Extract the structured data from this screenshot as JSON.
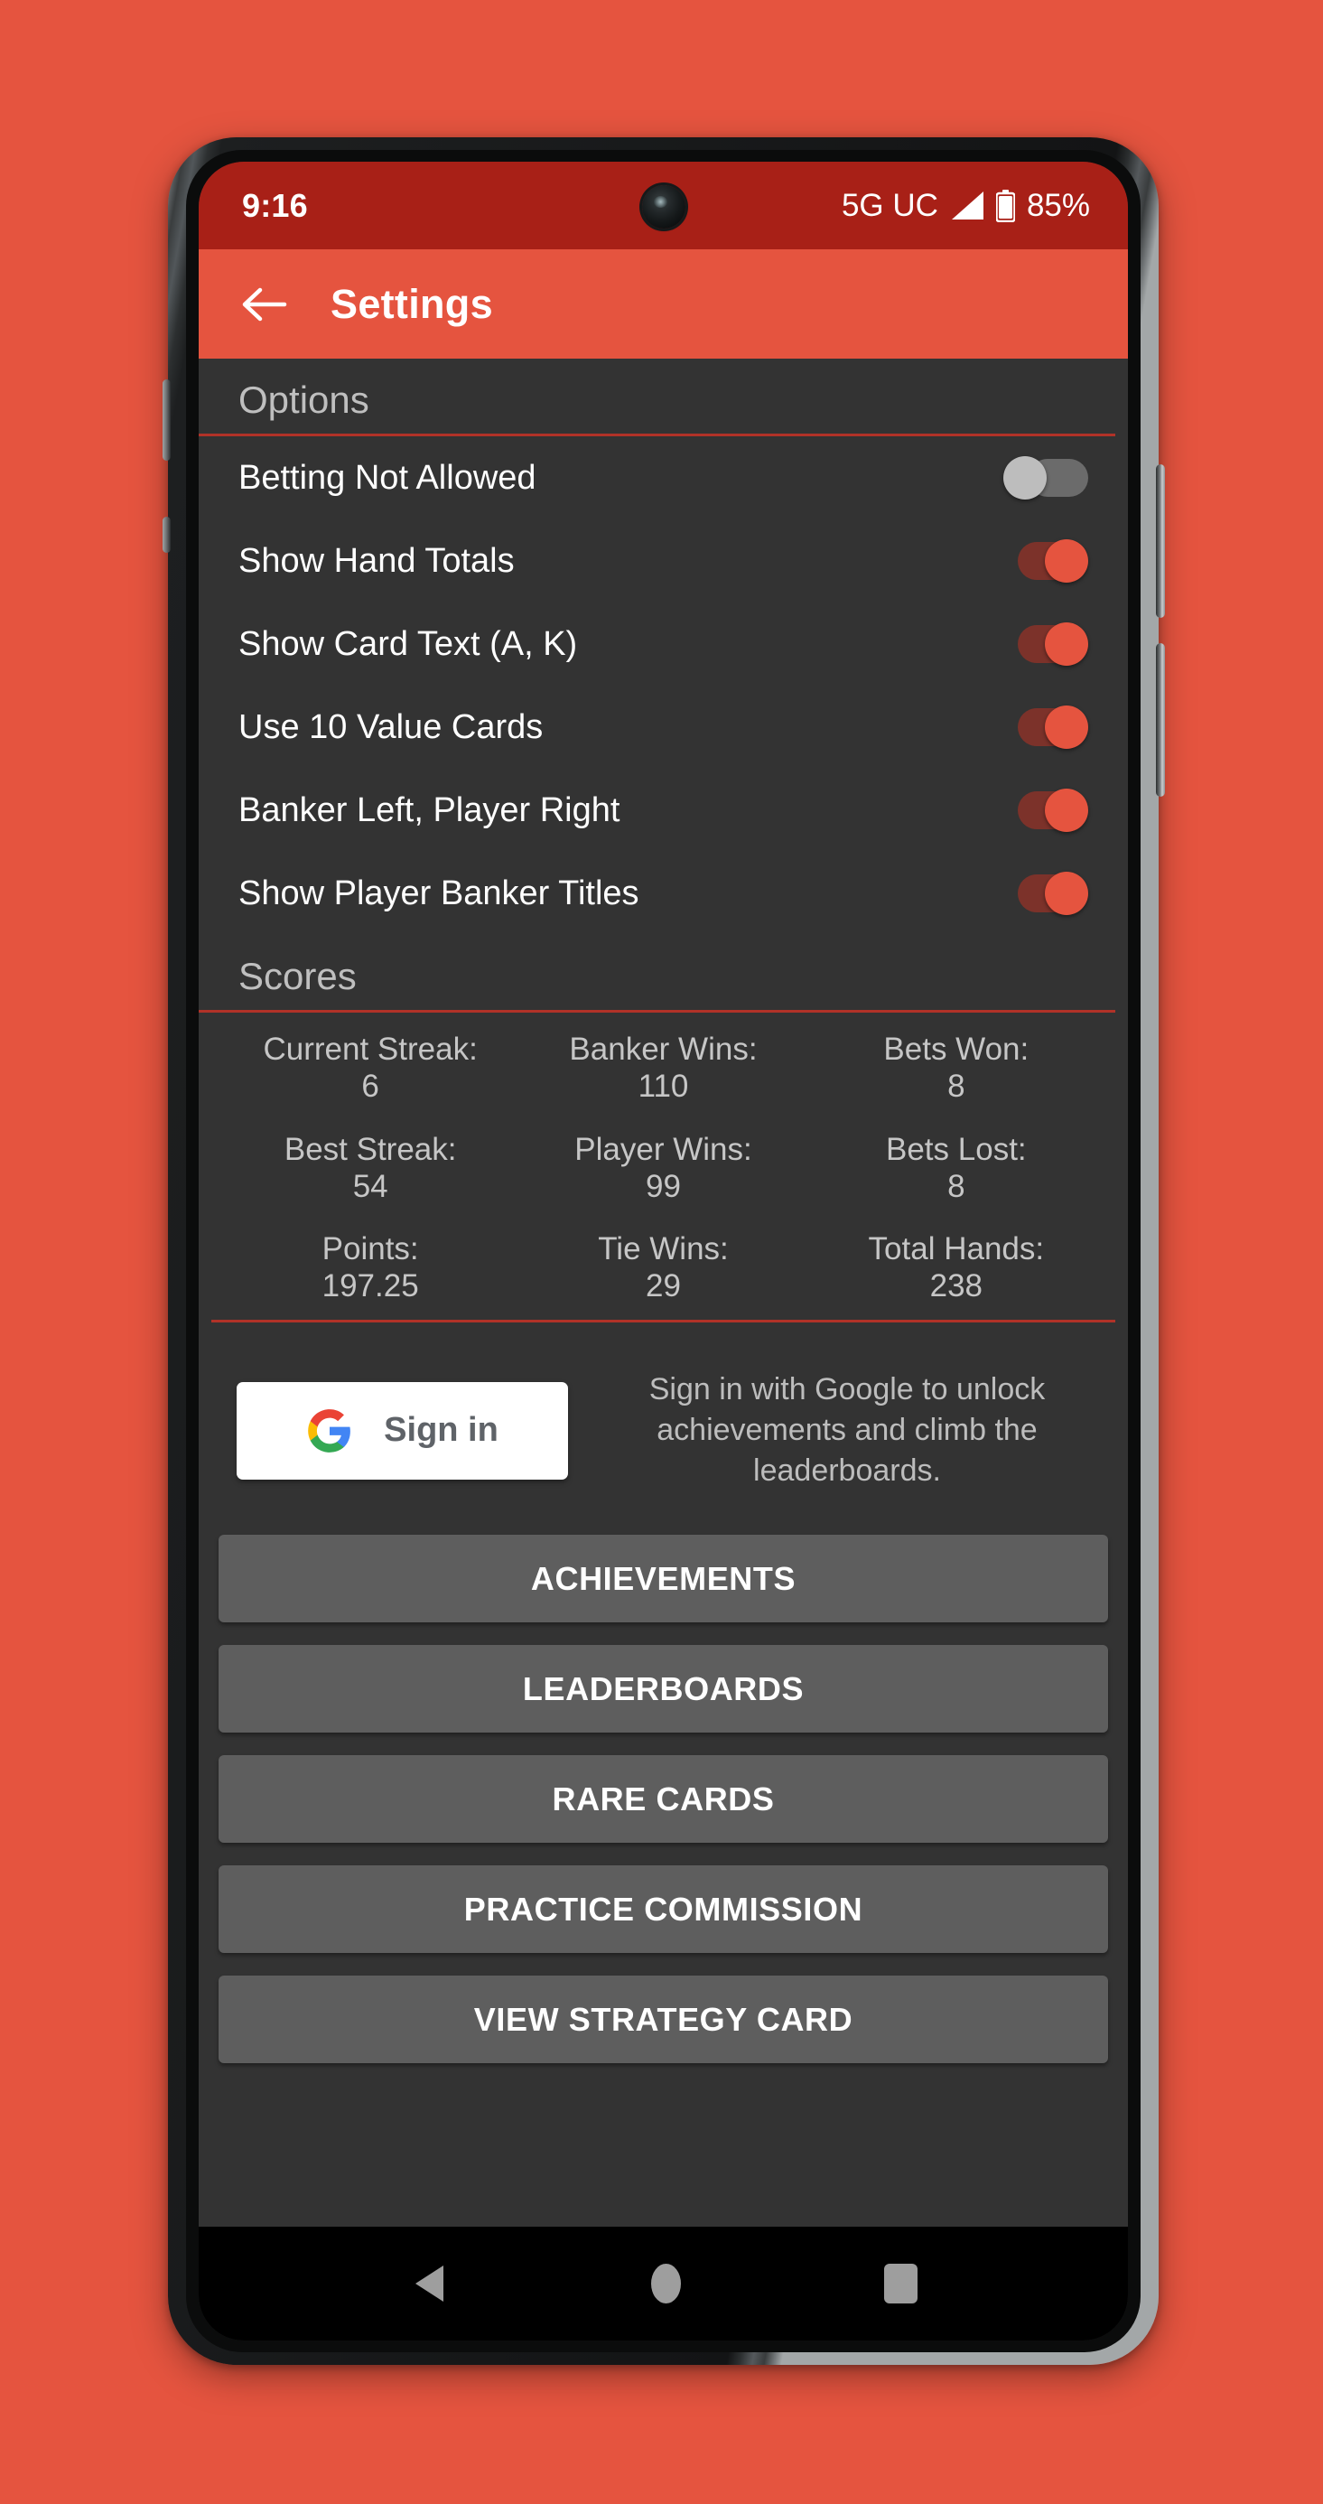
{
  "theme": {
    "accent": "#e5543f",
    "status_bar_bg": "#a82017",
    "content_bg": "#333333",
    "divider": "#b13228",
    "button_bg": "#5e5e5e"
  },
  "status_bar": {
    "time": "9:16",
    "network": "5G UC",
    "signal_icon": "signal-triangle-icon",
    "battery_icon": "battery-icon",
    "battery_percent": "85%"
  },
  "app_bar": {
    "back_icon": "back-arrow-icon",
    "title": "Settings"
  },
  "options": {
    "header": "Options",
    "items": [
      {
        "label": "Betting Not Allowed",
        "state": "off"
      },
      {
        "label": "Show Hand Totals",
        "state": "on"
      },
      {
        "label": "Show Card Text (A, K)",
        "state": "on"
      },
      {
        "label": "Use 10 Value Cards",
        "state": "on"
      },
      {
        "label": "Banker Left, Player Right",
        "state": "on"
      },
      {
        "label": "Show Player Banker Titles",
        "state": "on"
      }
    ]
  },
  "scores": {
    "header": "Scores",
    "cells": [
      {
        "label": "Current Streak:",
        "value": "6"
      },
      {
        "label": "Banker Wins:",
        "value": "110"
      },
      {
        "label": "Bets Won:",
        "value": "8"
      },
      {
        "label": "Best Streak:",
        "value": "54"
      },
      {
        "label": "Player Wins:",
        "value": "99"
      },
      {
        "label": "Bets Lost:",
        "value": "8"
      },
      {
        "label": "Points:",
        "value": "197.25"
      },
      {
        "label": "Tie Wins:",
        "value": "29"
      },
      {
        "label": "Total Hands:",
        "value": "238"
      }
    ]
  },
  "signin": {
    "google_icon": "google-g-icon",
    "button_label": "Sign in",
    "description": "Sign in with Google to unlock achievements and climb the leaderboards."
  },
  "action_buttons": [
    {
      "label": "ACHIEVEMENTS"
    },
    {
      "label": "LEADERBOARDS"
    },
    {
      "label": "RARE CARDS"
    },
    {
      "label": "PRACTICE COMMISSION"
    },
    {
      "label": "VIEW STRATEGY CARD"
    }
  ],
  "nav_bar": {
    "back": "nav-back-icon",
    "home": "nav-home-icon",
    "recents": "nav-recents-icon"
  }
}
